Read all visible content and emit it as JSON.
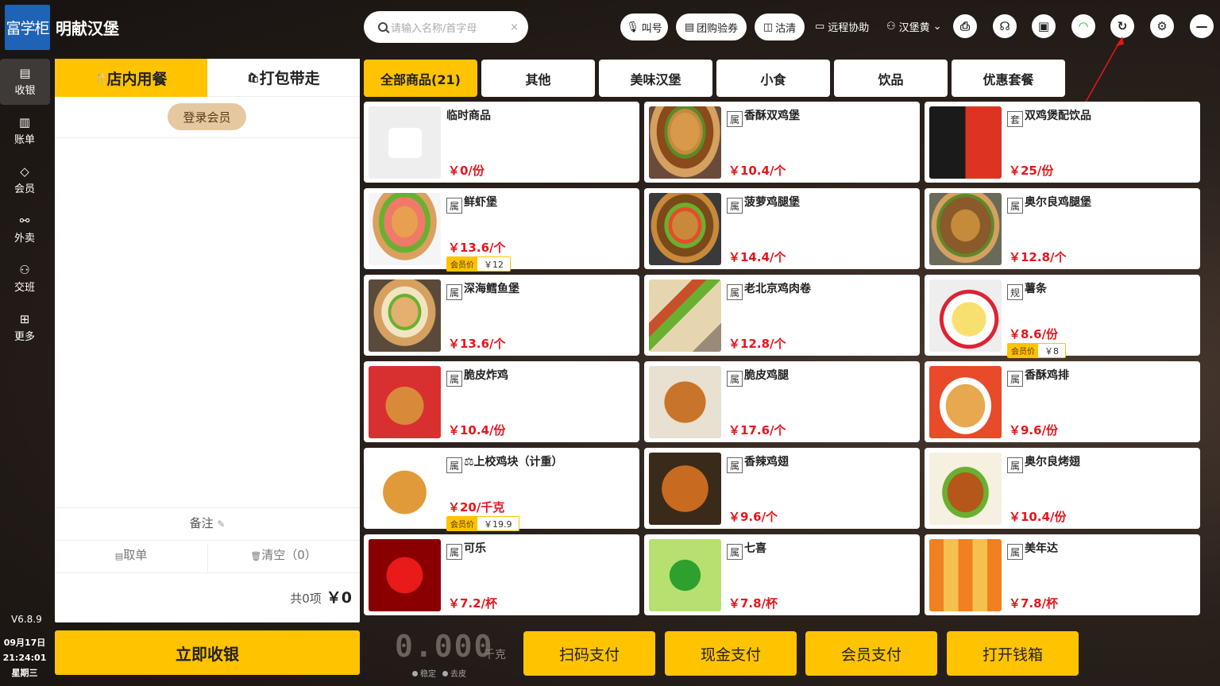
{
  "header": {
    "logo_text": "富学柜",
    "store_name": "明献汉堡",
    "search_placeholder": "请输入名称/首字母",
    "search_clear": "×",
    "call_number": "叫号",
    "group_voucher": "团购验券",
    "clean": "沽清",
    "remote_assist": "远程协助",
    "user_name": "汉堡黄"
  },
  "sidebar": {
    "items": [
      {
        "label": "收银",
        "icon": "cashier-icon"
      },
      {
        "label": "账单",
        "icon": "bill-icon"
      },
      {
        "label": "会员",
        "icon": "diamond-icon"
      },
      {
        "label": "外卖",
        "icon": "delivery-icon"
      },
      {
        "label": "交班",
        "icon": "handover-icon"
      },
      {
        "label": "更多",
        "icon": "grid-icon"
      }
    ],
    "version": "V6.8.9",
    "date": "09月17日",
    "time": "21:24:01",
    "weekday": "星期三"
  },
  "order": {
    "tab_dine_in": "店内用餐",
    "tab_takeaway": "打包带走",
    "login_member": "登录会员",
    "remark": "备注",
    "take_order": "取单",
    "clear": "清空（0）",
    "count_text": "共0项",
    "total": "￥0",
    "checkout": "立即收银"
  },
  "categories": [
    "全部商品(21)",
    "其他",
    "美味汉堡",
    "小食",
    "饮品",
    "优惠套餐"
  ],
  "products": [
    {
      "name": "临时商品",
      "badge": "",
      "price": "￥0/份",
      "member_label": "",
      "member_price": "",
      "img": "bag"
    },
    {
      "name": "香酥双鸡堡",
      "badge": "属",
      "price": "￥10.4/个",
      "member_label": "",
      "member_price": "",
      "img": "burger"
    },
    {
      "name": "双鸡煲配饮品",
      "badge": "套",
      "price": "￥25/份",
      "member_label": "",
      "member_price": "",
      "img": "combo"
    },
    {
      "name": "鲜虾堡",
      "badge": "属",
      "price": "￥13.6/个",
      "member_label": "会员价",
      "member_price": "￥12",
      "img": "shrimp"
    },
    {
      "name": "菠萝鸡腿堡",
      "badge": "属",
      "price": "￥14.4/个",
      "member_label": "",
      "member_price": "",
      "img": "burger2"
    },
    {
      "name": "奥尔良鸡腿堡",
      "badge": "属",
      "price": "￥12.8/个",
      "member_label": "",
      "member_price": "",
      "img": "burger3"
    },
    {
      "name": "深海鳕鱼堡",
      "badge": "属",
      "price": "￥13.6/个",
      "member_label": "",
      "member_price": "",
      "img": "fish"
    },
    {
      "name": "老北京鸡肉卷",
      "badge": "属",
      "price": "￥12.8/个",
      "member_label": "",
      "member_price": "",
      "img": "wrap"
    },
    {
      "name": "薯条",
      "badge": "规",
      "price": "￥8.6/份",
      "member_label": "会员价",
      "member_price": "￥8",
      "img": "fries"
    },
    {
      "name": "脆皮炸鸡",
      "badge": "属",
      "price": "￥10.4/份",
      "member_label": "",
      "member_price": "",
      "img": "friedred"
    },
    {
      "name": "脆皮鸡腿",
      "badge": "属",
      "price": "￥17.6/个",
      "member_label": "",
      "member_price": "",
      "img": "drum"
    },
    {
      "name": "香酥鸡排",
      "badge": "属",
      "price": "￥9.6/份",
      "member_label": "",
      "member_price": "",
      "img": "cutlet"
    },
    {
      "name": "⚖上校鸡块（计重）",
      "badge": "属",
      "price": "￥20/千克",
      "member_label": "会员价",
      "member_price": "￥19.9",
      "img": "nugget"
    },
    {
      "name": "香辣鸡翅",
      "badge": "属",
      "price": "￥9.6/个",
      "member_label": "",
      "member_price": "",
      "img": "wing"
    },
    {
      "name": "奥尔良烤翅",
      "badge": "属",
      "price": "￥10.4/份",
      "member_label": "",
      "member_price": "",
      "img": "wing2"
    },
    {
      "name": "可乐",
      "badge": "属",
      "price": "￥7.2/杯",
      "member_label": "",
      "member_price": "",
      "img": "cola"
    },
    {
      "name": "七喜",
      "badge": "属",
      "price": "￥7.8/杯",
      "member_label": "",
      "member_price": "",
      "img": "sevenup"
    },
    {
      "name": "美年达",
      "badge": "属",
      "price": "￥7.8/杯",
      "member_label": "",
      "member_price": "",
      "img": "mirinda"
    }
  ],
  "footer": {
    "scale_value": "0.000",
    "scale_unit": "千克",
    "scale_stable": "稳定",
    "scale_tare": "去皮",
    "pay_buttons": [
      "扫码支付",
      "现金支付",
      "会员支付",
      "打开钱箱"
    ]
  },
  "colors": {
    "accent": "#ffc300",
    "price": "#e8141c",
    "logo": "#1e63b5"
  }
}
